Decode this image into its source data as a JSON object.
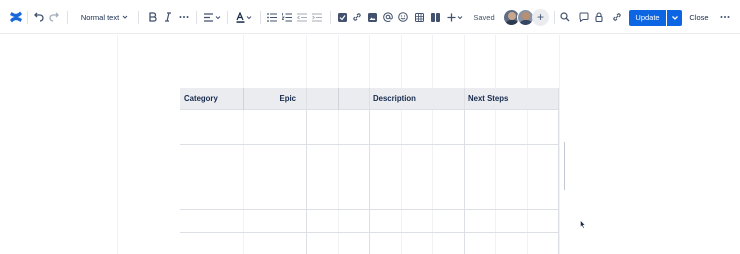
{
  "toolbar": {
    "logo_icon": "confluence-logo-icon",
    "text_style": "Normal text",
    "saved_label": "Saved",
    "update_label": "Update",
    "close_label": "Close",
    "accent_color": "#0c66e4"
  },
  "table": {
    "headers": [
      "Category",
      "Epic",
      "",
      "",
      "Description",
      "Next Steps"
    ],
    "rows": [
      [
        "",
        "",
        "",
        "",
        "",
        ""
      ],
      [
        "",
        "",
        "",
        "",
        "",
        ""
      ],
      [
        "",
        "",
        "",
        "",
        "",
        ""
      ],
      [
        "",
        "",
        "",
        "",
        "",
        ""
      ]
    ]
  }
}
